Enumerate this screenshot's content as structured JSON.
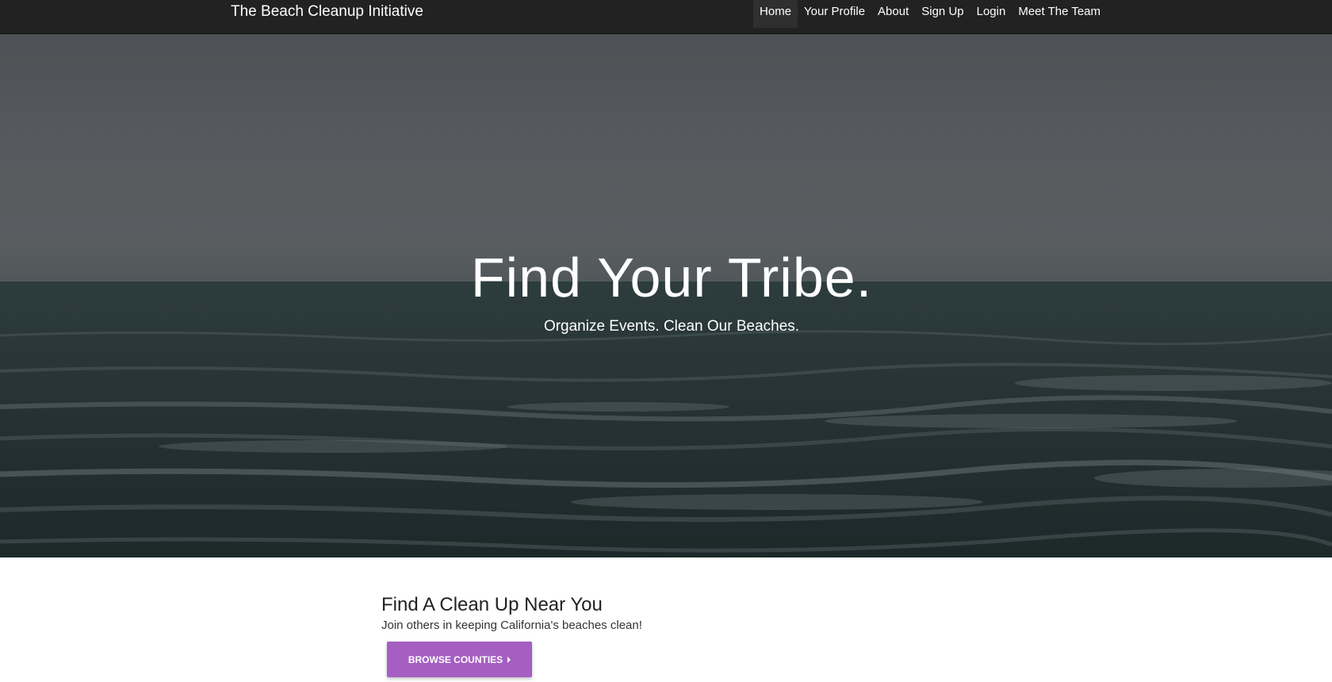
{
  "navbar": {
    "brand": "The Beach Cleanup Initiative",
    "items": [
      {
        "label": "Home",
        "active": true
      },
      {
        "label": "Your Profile",
        "active": false
      },
      {
        "label": "About",
        "active": false
      },
      {
        "label": "Sign Up",
        "active": false
      },
      {
        "label": "Login",
        "active": false
      },
      {
        "label": "Meet The Team",
        "active": false
      }
    ]
  },
  "hero": {
    "title": "Find Your Tribe.",
    "subtitle": "Organize Events. Clean Our Beaches.",
    "background_image": "ocean-waves-image"
  },
  "main": {
    "heading": "Find A Clean Up Near You",
    "text": "Join others in keeping California's beaches clean!",
    "browse_button": {
      "label": "BROWSE COUNTIES",
      "icon": "caret-right-icon"
    }
  },
  "colors": {
    "navbar_bg": "#222222",
    "button_accent": "#a55fc3",
    "hero_overlay": "#2b3a3b"
  }
}
